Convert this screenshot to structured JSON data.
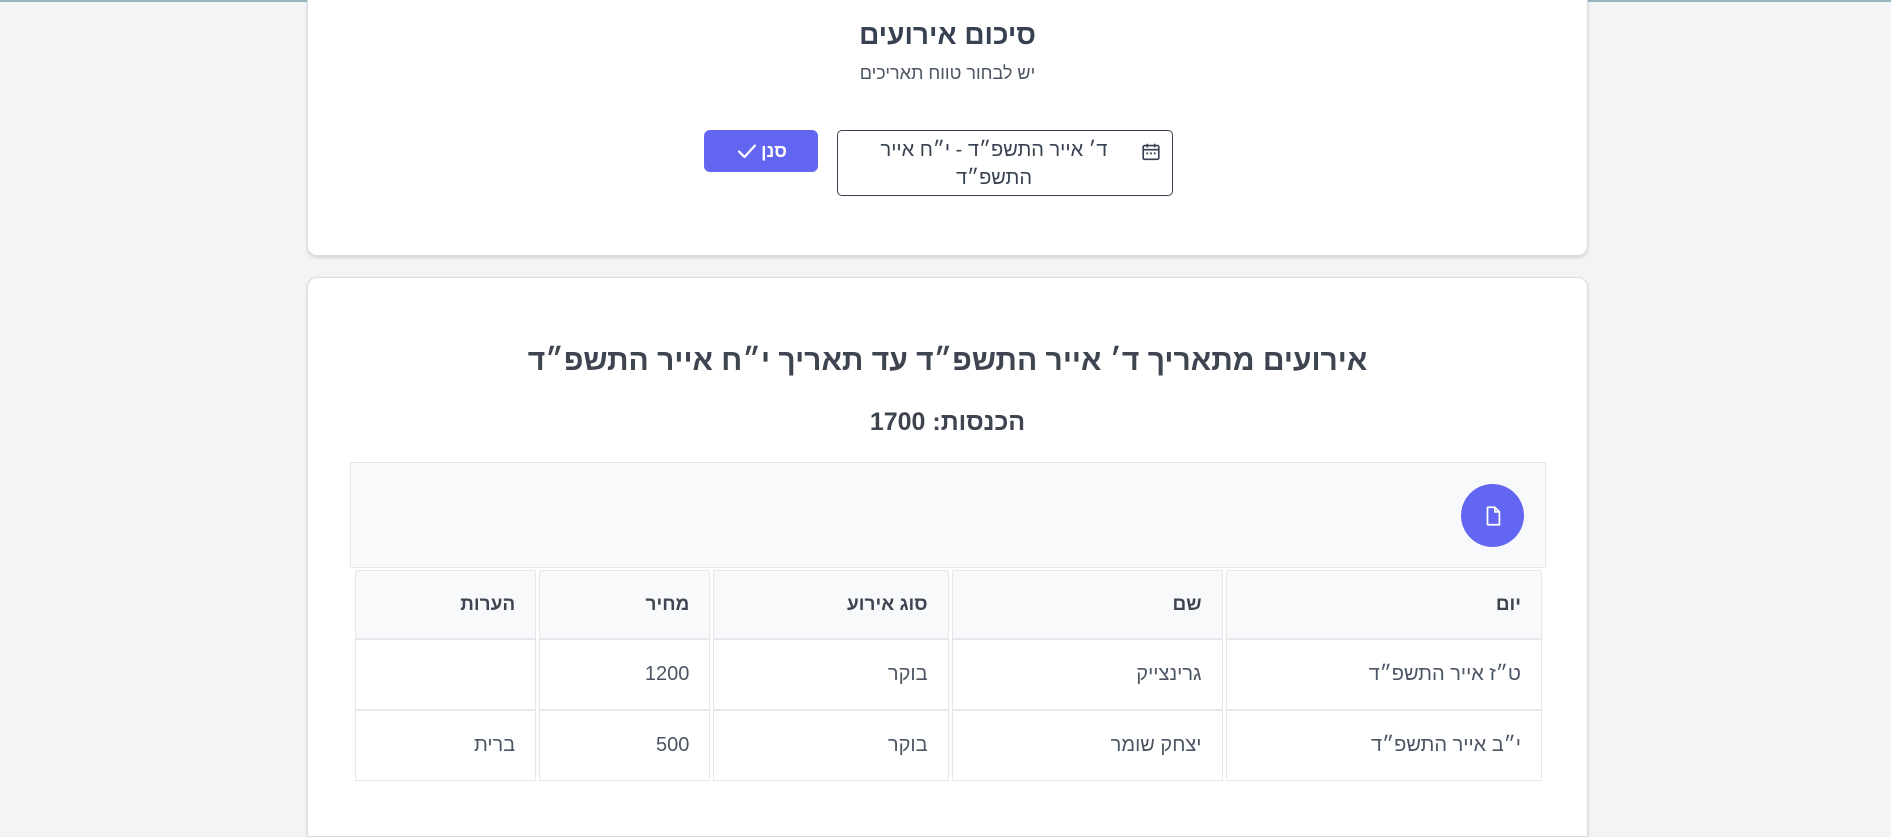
{
  "summary": {
    "title": "סיכום אירועים",
    "subtitle": "יש לבחור טווח תאריכים",
    "date_range_value": "ד׳ אייר התשפ״ד - י״ח אייר התשפ״ד",
    "filter_button_label": "סנן"
  },
  "report": {
    "title": "אירועים מתאריך ד׳ אייר התשפ״ד עד תאריך י״ח אייר התשפ״ד",
    "income_label": "הכנסות:",
    "income_value": "1700",
    "table": {
      "headers": [
        "יום",
        "שם",
        "סוג אירוע",
        "מחיר",
        "הערות"
      ],
      "rows": [
        [
          "ט״ז אייר התשפ״ד",
          "גרינצייק",
          "בוקר",
          "1200",
          ""
        ],
        [
          "י״ב אייר התשפ״ד",
          "יצחק שומר",
          "בוקר",
          "500",
          "ברית"
        ]
      ]
    }
  },
  "icons": {
    "date_input": "calendar-icon",
    "filter_button": "check-icon",
    "export_button": "file-icon"
  },
  "colors": {
    "accent": "#6366f1",
    "page_background": "#f3f4f6",
    "text": "#374151",
    "top_border": "#9ab4bf"
  }
}
